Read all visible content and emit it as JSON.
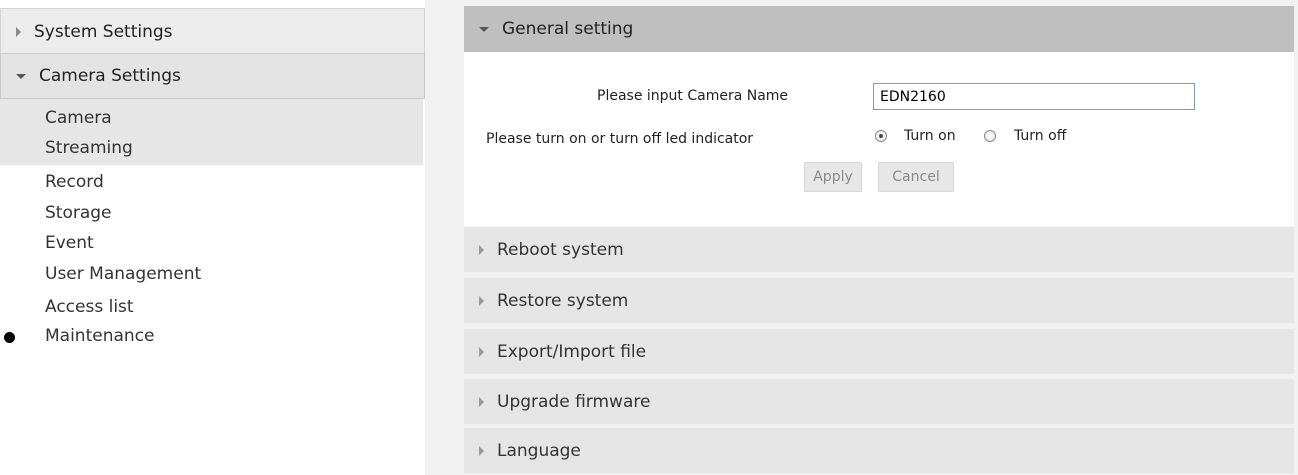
{
  "nav": {
    "system_settings": "System Settings",
    "camera_settings": "Camera Settings",
    "items": [
      "Camera",
      "Streaming",
      "Record",
      "Storage",
      "Event",
      "User Management",
      "Access list",
      "Maintenance"
    ]
  },
  "general": {
    "title": "General setting",
    "camera_name_label": "Please input Camera Name",
    "camera_name_value": "EDN2160",
    "led_label": "Please turn on or turn off led indicator",
    "turn_on": "Turn on",
    "turn_off": "Turn off",
    "led_selected": "Turn on",
    "apply": "Apply",
    "cancel": "Cancel"
  },
  "sections": [
    "Reboot system",
    "Restore system",
    "Export/Import file",
    "Upgrade firmware",
    "Language"
  ]
}
